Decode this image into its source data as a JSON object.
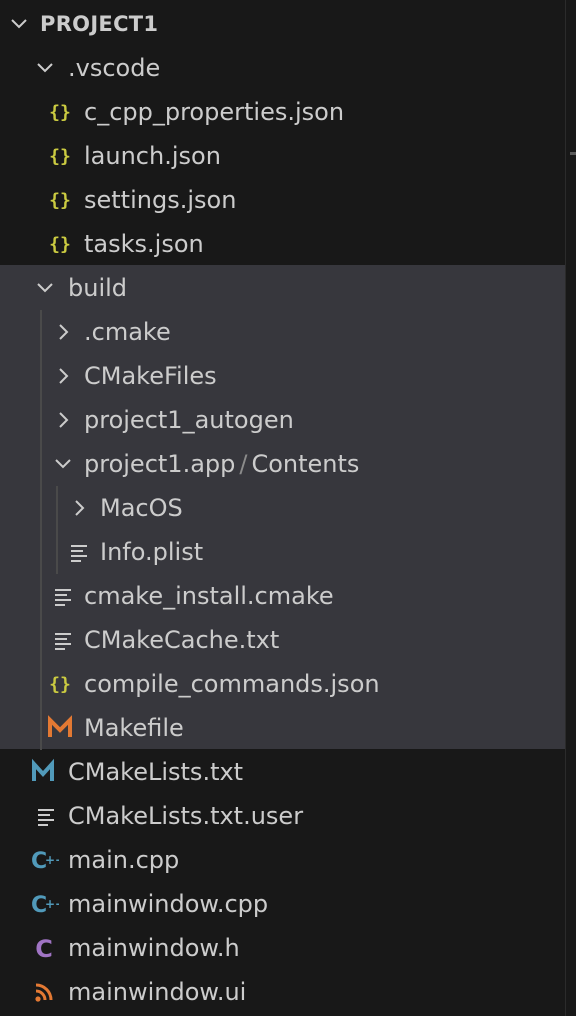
{
  "explorer": {
    "root": {
      "label": "PROJECT1",
      "icon": "chevron-down-icon"
    },
    "items": [
      {
        "label": ".vscode",
        "kind": "folder",
        "expanded": true,
        "icon": "chevron-down-icon"
      },
      {
        "label": "c_cpp_properties.json",
        "kind": "file",
        "icon": "json-braces-icon"
      },
      {
        "label": "launch.json",
        "kind": "file",
        "icon": "json-braces-icon"
      },
      {
        "label": "settings.json",
        "kind": "file",
        "icon": "json-braces-icon"
      },
      {
        "label": "tasks.json",
        "kind": "file",
        "icon": "json-braces-icon"
      },
      {
        "label": "build",
        "kind": "folder",
        "expanded": true,
        "icon": "chevron-down-icon"
      },
      {
        "label": ".cmake",
        "kind": "folder",
        "expanded": false,
        "icon": "chevron-right-icon"
      },
      {
        "label": "CMakeFiles",
        "kind": "folder",
        "expanded": false,
        "icon": "chevron-right-icon"
      },
      {
        "label": "project1_autogen",
        "kind": "folder",
        "expanded": false,
        "icon": "chevron-right-icon"
      },
      {
        "label": "project1.app",
        "label_sep": "/",
        "label_tail": "Contents",
        "kind": "folder",
        "expanded": true,
        "icon": "chevron-down-icon"
      },
      {
        "label": "MacOS",
        "kind": "folder",
        "expanded": false,
        "icon": "chevron-right-icon"
      },
      {
        "label": "Info.plist",
        "kind": "file",
        "icon": "text-lines-icon"
      },
      {
        "label": "cmake_install.cmake",
        "kind": "file",
        "icon": "text-lines-icon"
      },
      {
        "label": "CMakeCache.txt",
        "kind": "file",
        "icon": "text-lines-icon"
      },
      {
        "label": "compile_commands.json",
        "kind": "file",
        "icon": "json-braces-icon"
      },
      {
        "label": "Makefile",
        "kind": "file",
        "icon": "makefile-m-icon"
      },
      {
        "label": "CMakeLists.txt",
        "kind": "file",
        "icon": "cmake-m-icon"
      },
      {
        "label": "CMakeLists.txt.user",
        "kind": "file",
        "icon": "text-lines-icon"
      },
      {
        "label": "main.cpp",
        "kind": "file",
        "icon": "cpp-file-icon"
      },
      {
        "label": "mainwindow.cpp",
        "kind": "file",
        "icon": "cpp-file-icon"
      },
      {
        "label": "mainwindow.h",
        "kind": "file",
        "icon": "c-header-icon"
      },
      {
        "label": "mainwindow.ui",
        "kind": "file",
        "icon": "rss-feed-icon"
      }
    ]
  },
  "colors": {
    "background": "#181818",
    "highlight": "#37373d",
    "text": "#cccccc",
    "json_icon": "#cbcb41",
    "makefile_icon": "#e37933",
    "cmake_icon": "#519aba",
    "cpp_icon": "#519aba",
    "header_icon": "#a074c4",
    "rss_icon": "#e37933",
    "lines_icon": "#cccccc"
  }
}
